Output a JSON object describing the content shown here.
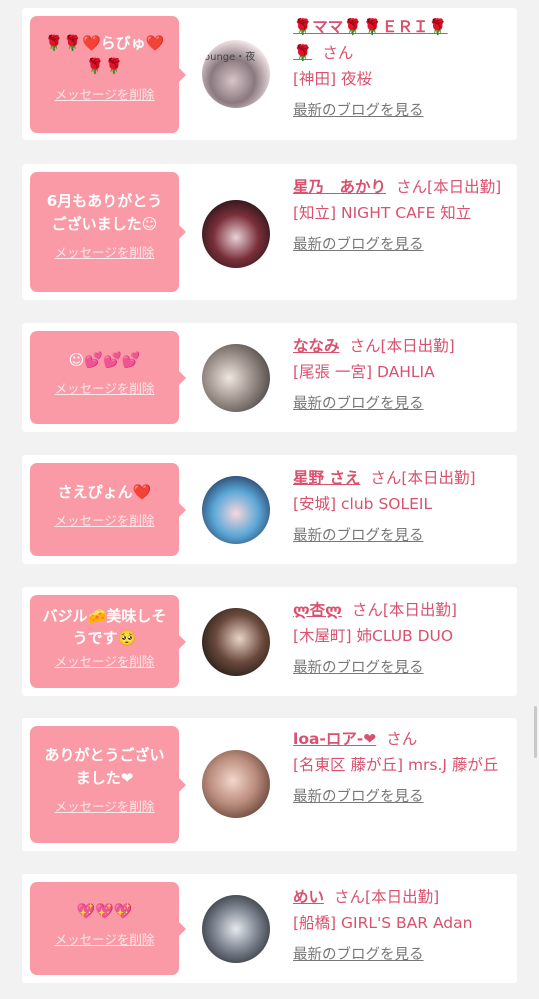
{
  "cards": [
    {
      "message": "🌹🌹❤️らびゅ❤️\n🌹🌹",
      "delete_label": "メッセージを削除",
      "name": "🌹ママ🌹🌹ＥＲＩ🌹\n🌹",
      "suffix": "さん",
      "status": "",
      "shop": "[神田] 夜桜",
      "blog_label": "最新のブログを見る",
      "avatar_text": "ounge・夜"
    },
    {
      "message": "6月もありがとう\nございました☺",
      "delete_label": "メッセージを削除",
      "name": "星乃　あかり",
      "suffix": "さん",
      "status": "[本日出勤]",
      "shop": "[知立] NIGHT CAFE 知立",
      "blog_label": "最新のブログを見る"
    },
    {
      "message": "☺💕💕💕",
      "delete_label": "メッセージを削除",
      "name": "ななみ",
      "suffix": "さん",
      "status": "[本日出勤]",
      "shop": "[尾張 一宮] DAHLIA",
      "blog_label": "最新のブログを見る"
    },
    {
      "message": "さえぴょん❤️",
      "delete_label": "メッセージを削除",
      "name": "星野 さえ",
      "suffix": "さん",
      "status": "[本日出勤]",
      "shop": "[安城] club SOLEIL",
      "blog_label": "最新のブログを見る"
    },
    {
      "message": "バジル🧀美味しそ\nうです🥺",
      "delete_label": "メッセージを削除",
      "name": "ლ杏ლ",
      "suffix": "さん",
      "status": "[本日出勤]",
      "shop": "[木屋町] 姉CLUB DUO",
      "blog_label": "最新のブログを見る"
    },
    {
      "message": "ありがとうござい\nました❤",
      "delete_label": "メッセージを削除",
      "name": "loa-ロア-❤",
      "suffix": "さん",
      "status": "",
      "shop": "[名東区 藤が丘] mrs.J 藤が丘",
      "blog_label": "最新のブログを見る"
    },
    {
      "message": "💖💖💖",
      "delete_label": "メッセージを削除",
      "name": "めい",
      "suffix": "さん",
      "status": "[本日出勤]",
      "shop": "[船橋] GIRL'S BAR Adan",
      "blog_label": "最新のブログを見る"
    }
  ]
}
